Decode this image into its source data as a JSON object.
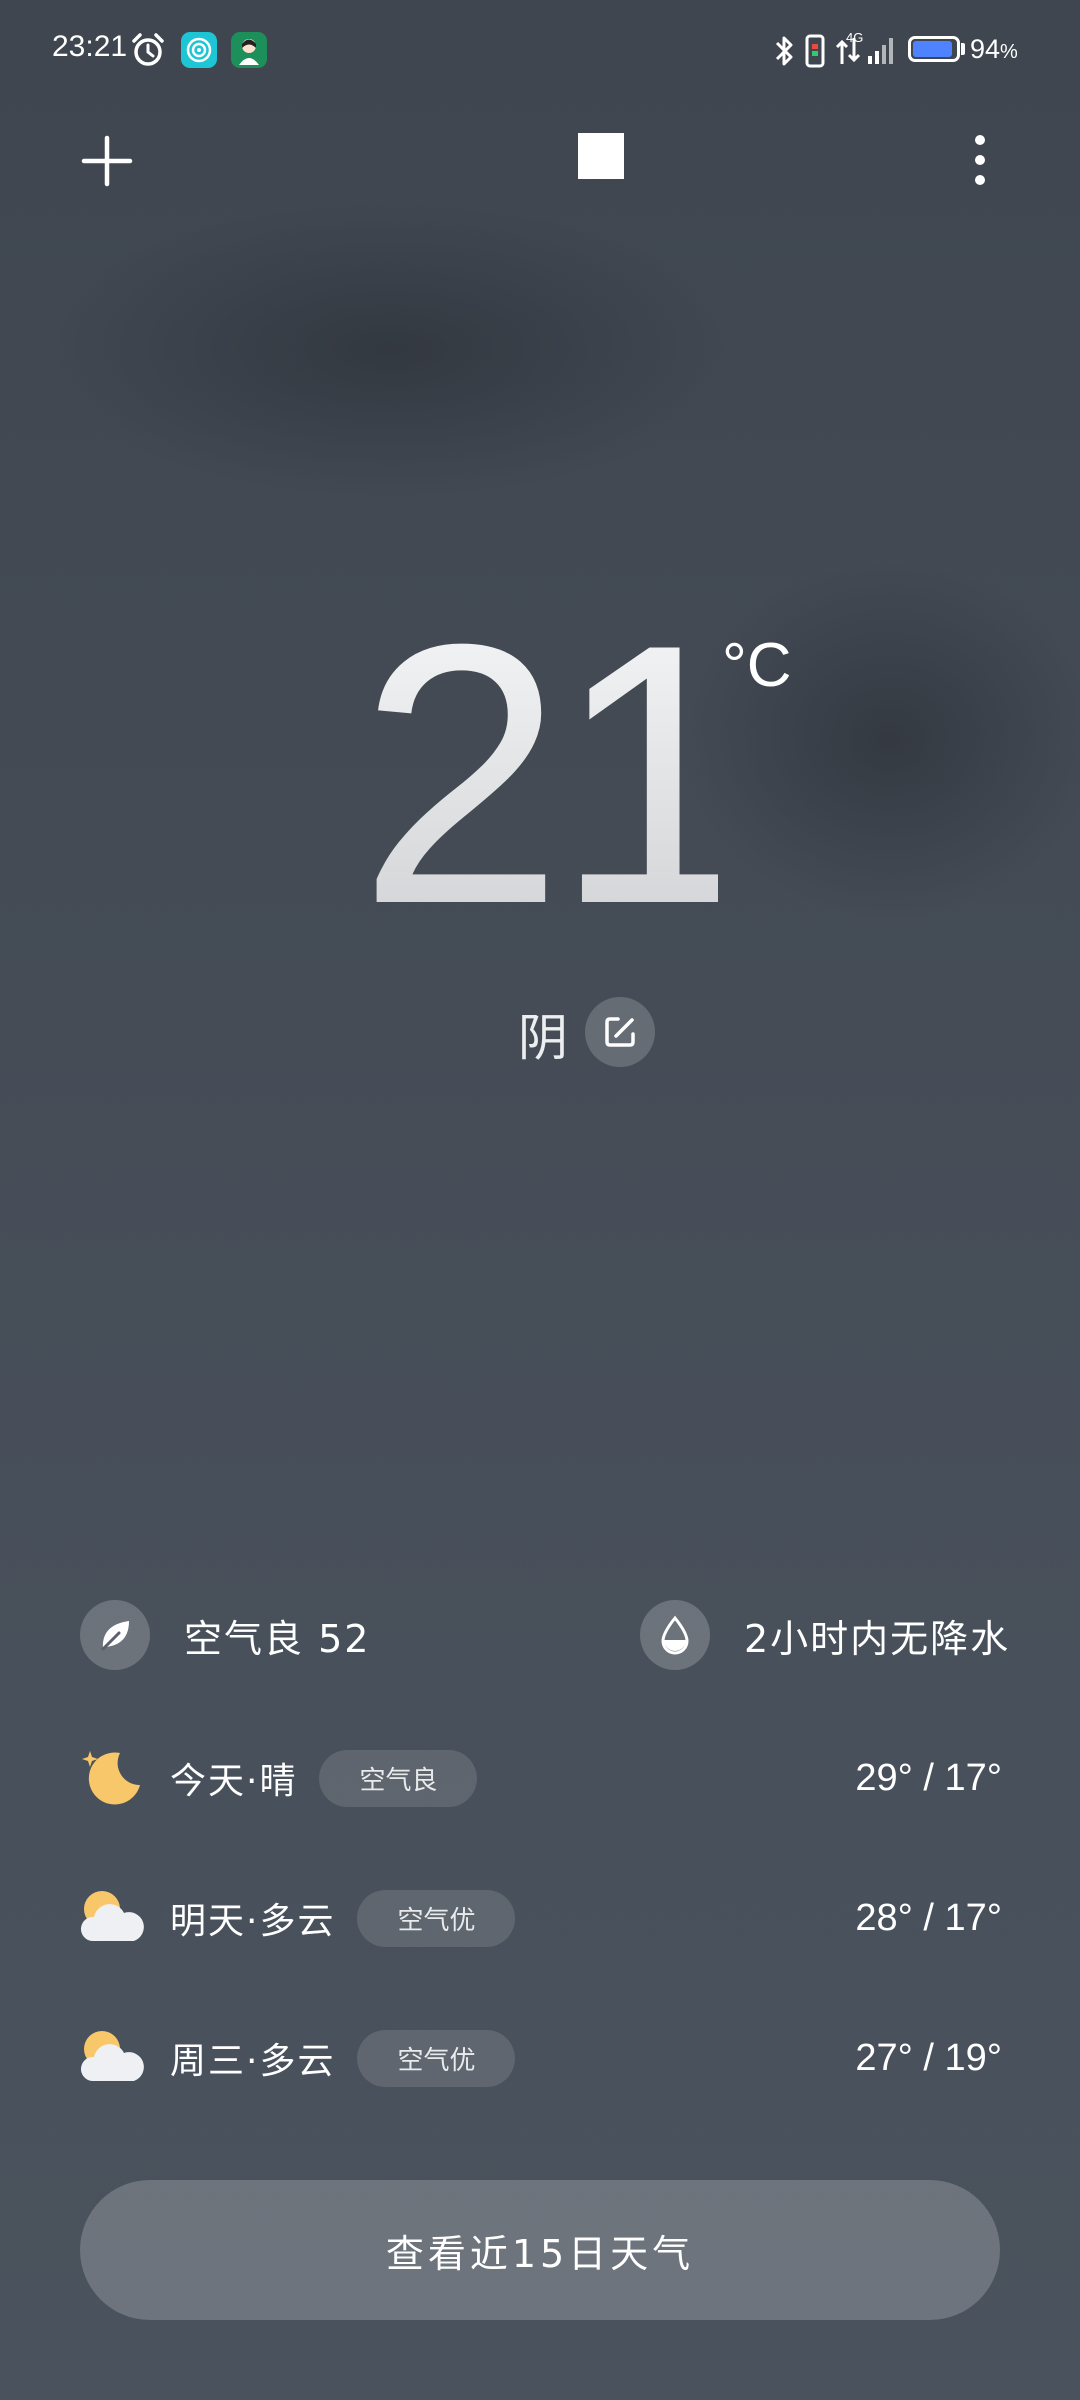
{
  "status_bar": {
    "time": "23:21",
    "network": "4G",
    "battery_percent": "94",
    "battery_unit": "%"
  },
  "current": {
    "temperature": "21",
    "unit": "°C",
    "condition": "阴"
  },
  "info": {
    "air_quality": "空气良 52",
    "precipitation": "2小时内无降水"
  },
  "forecast": [
    {
      "day": "今天·晴",
      "aqi": "空气良",
      "range": "29° / 17°",
      "icon": "moon-icon"
    },
    {
      "day": "明天·多云",
      "aqi": "空气优",
      "range": "28° / 17°",
      "icon": "partly-cloudy-icon"
    },
    {
      "day": "周三·多云",
      "aqi": "空气优",
      "range": "27° / 19°",
      "icon": "partly-cloudy-icon"
    }
  ],
  "cta_label": "查看近15日天气",
  "colors": {
    "battery": "#4f82ff",
    "sun": "#f8c76a"
  }
}
